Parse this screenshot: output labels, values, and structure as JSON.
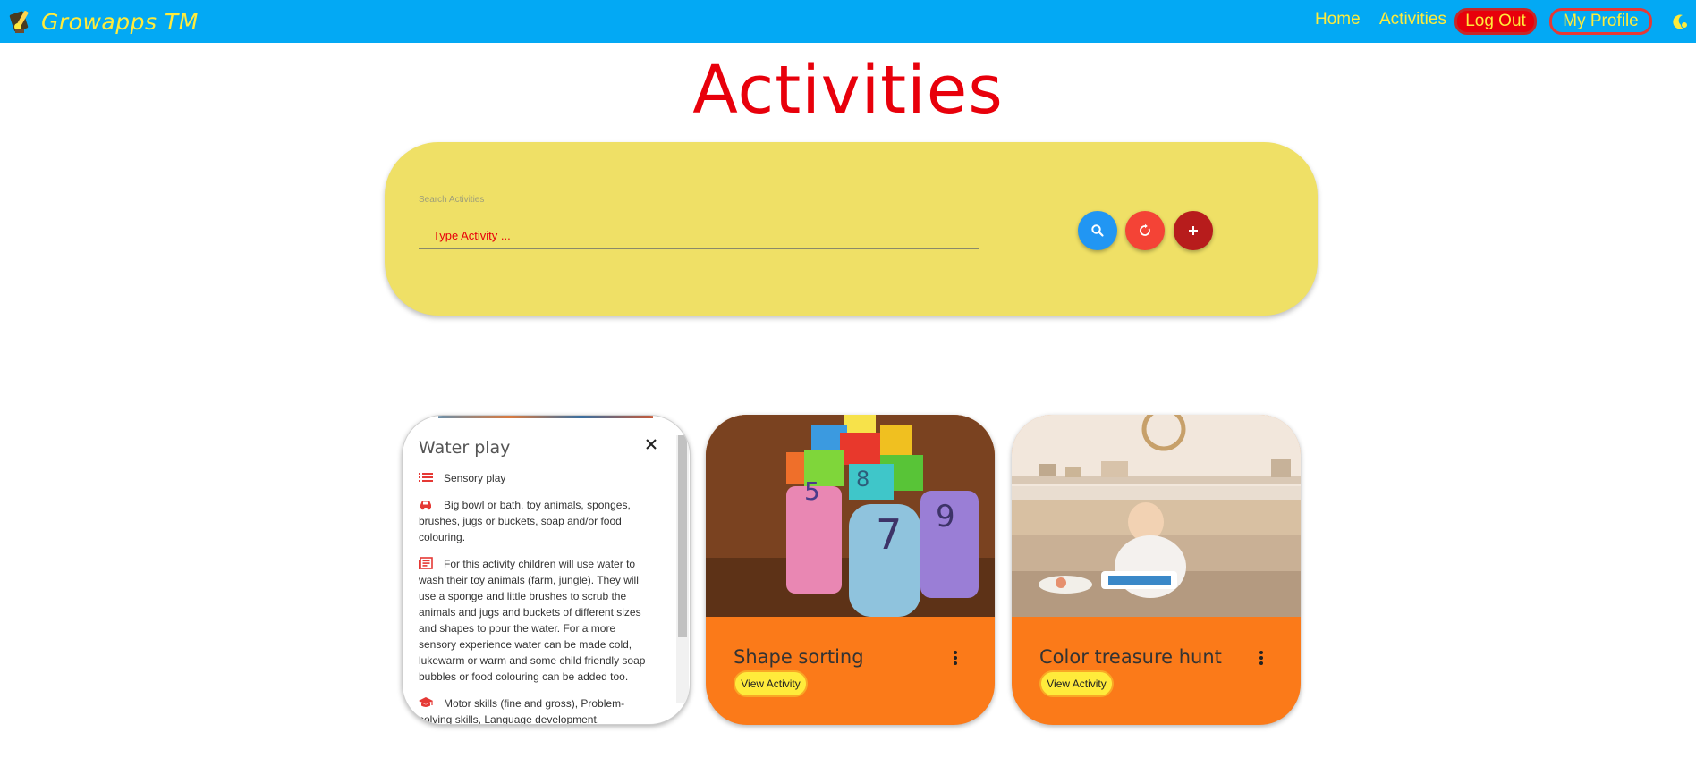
{
  "nav": {
    "brand": "Growapps TM",
    "home": "Home",
    "activities": "Activities",
    "logout": "Log Out",
    "profile": "My Profile"
  },
  "page": {
    "title": "Activities"
  },
  "search": {
    "label": "Search Activities",
    "placeholder": "Type Activity ..."
  },
  "cards": [
    {
      "title": "Water play",
      "category": "Sensory play",
      "materials": "Big bowl or bath, toy animals, sponges, brushes, jugs or buckets, soap and/or food colouring.",
      "description": "For this activity children will use water to wash their toy animals (farm, jungle). They will use a sponge and little brushes to scrub the animals and jugs and buckets of different sizes and shapes to pour the water. For a more sensory experience water can be made cold, lukewarm or warm and some child friendly soap bubbles or food colouring can be added too.",
      "skills": "Motor skills (fine and gross), Problem-solving skills, Language development,"
    },
    {
      "title": "Shape sorting",
      "view_label": "View Activity"
    },
    {
      "title": "Color treasure hunt",
      "view_label": "View Activity"
    }
  ],
  "colors": {
    "navbar": "#03a9f4",
    "accent_yellow": "#ffeb3b",
    "title_red": "#e8000b",
    "panel": "#efe066",
    "card_orange": "#fb7a19"
  }
}
